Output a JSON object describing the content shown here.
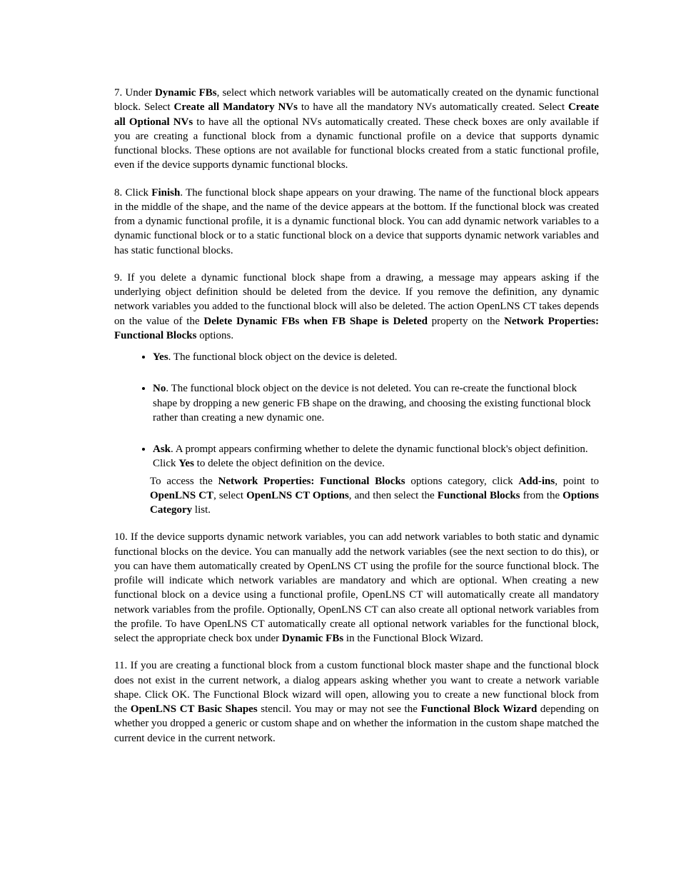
{
  "para1_a": "7. Under ",
  "para1_b": "Dynamic FBs",
  "para1_c": ", select which network variables will be automatically created on the dynamic functional block. Select ",
  "para1_d": "Create all Mandatory NVs",
  "para1_e": " to have all the mandatory NVs automatically created. Select ",
  "para1_f": "Create all Optional NVs",
  "para1_g": " to have all the optional NVs automatically created. These check boxes are only available if you are creating a functional block from a dynamic functional profile on a device that supports dynamic functional blocks. These options are not available for functional blocks created from a static functional profile, even if the device supports dynamic functional blocks.",
  "para2_a": "8. Click ",
  "para2_b": "Finish",
  "para2_c": ". The functional block shape appears on your drawing. The name of the functional block appears in the middle of the shape, and the name of the device appears at the bottom. If the functional block was created from a dynamic functional profile, it is a dynamic functional block. You can add dynamic network variables to a dynamic functional block or to a static functional block on a device that supports dynamic network variables and has static functional blocks.",
  "para3_a": "9. If you delete a dynamic functional block shape from a drawing, a message may appears asking if the underlying object definition should be deleted from the device. If you remove the definition, any dynamic network variables you added to the functional block will also be deleted. The action OpenLNS CT takes depends on the value of the ",
  "para3_b": "Delete Dynamic FBs when FB Shape is Deleted",
  "para3_c": " property on the ",
  "para3_d": "Network Properties: Functional Blocks",
  "para3_e": " options.",
  "bullet_yes_a": "Yes",
  "bullet_yes_b": ". The functional block object on the device is deleted.",
  "bullet_no_a": "No",
  "bullet_no_b": ". The functional block object on the device is not deleted. You can re-create the functional block shape by dropping a new generic FB shape on the drawing, and choosing the existing functional block rather than creating a new dynamic one.",
  "bullet_ask_a": "Ask",
  "bullet_ask_b": ". A prompt appears confirming whether to delete the dynamic functional block's object definition. Click ",
  "bullet_ask_c": "Yes",
  "bullet_ask_d": " to delete the object definition on the device.",
  "para4_a": "To access the ",
  "para4_b": "Network Properties: Functional Blocks",
  "para4_c": " options category, click ",
  "para4_d": "Add-ins",
  "para4_e": ", point to ",
  "para4_f": "OpenLNS CT",
  "para4_g": ", select ",
  "para4_h": "OpenLNS CT Options",
  "para4_i": ", and then select the ",
  "para4_j": "Functional Blocks",
  "para4_k": " from the ",
  "para4_l": "Options Category",
  "para4_m": " list.",
  "para5_a": "10. If the device supports dynamic network variables, you can add network variables to both static and dynamic functional blocks on the device. You can manually add the network variables (see the next section to do this), or you can have them automatically created by OpenLNS CT using the profile for the source functional block. The profile will indicate which network variables are mandatory and which are optional. When creating a new functional block on a device using a functional profile, OpenLNS CT will automatically create all mandatory network variables from the profile. Optionally, OpenLNS CT can also create all optional network variables from the profile. To have OpenLNS CT automatically create all optional network variables for the functional block, select the appropriate check box under ",
  "para5_b": "Dynamic FBs",
  "para5_c": " in the Functional Block Wizard.",
  "para6_a": "11. If you are creating a functional block from a custom functional block master shape and the functional block does not exist in the current network, a dialog appears asking whether you want to create a network variable shape. Click OK. The Functional Block wizard will open, allowing you to create a new functional block from the ",
  "para6_b": "OpenLNS CT Basic Shapes",
  "para6_c": " stencil. You may or may not see the ",
  "para6_d": "Functional Block Wizard",
  "para6_e": " depending on whether you dropped a generic or custom shape and on whether the information in the custom shape matched the current device in the current network."
}
